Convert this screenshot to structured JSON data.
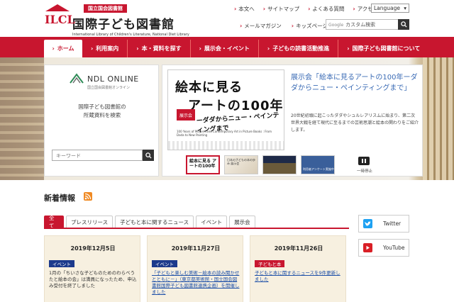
{
  "header": {
    "logo_mark": "ILCL",
    "logo_top": "国立国会図書館",
    "logo_main": "国際子ども図書館",
    "logo_sub": "International Library of Children's Literature, National Diet Library",
    "util_links": [
      "本文へ",
      "サイトマップ",
      "よくある質問",
      "アクセス"
    ],
    "language": "Language",
    "util_links2": [
      "メールマガジン",
      "キッズページ"
    ],
    "search_brand": "Google",
    "search_placeholder": "カスタム検索"
  },
  "nav": {
    "items": [
      "ホーム",
      "利用案内",
      "本・資料を探す",
      "展示会・イベント",
      "子どもの読書活動推進",
      "国際子ども図書館について"
    ]
  },
  "ndl": {
    "title": "NDL ONLINE",
    "sub": "国立国会図書館オンライン",
    "desc_line1": "国際子ども図書館の",
    "desc_line2": "所蔵資料を検索",
    "keyword_placeholder": "キーワード"
  },
  "exhibit": {
    "poster_line1": "絵本に見る",
    "poster_line2": "アートの100年",
    "poster_badge": "展示会",
    "poster_line3": "ーダダからニュー・ペインティングまで",
    "poster_small": "100 Years of Modern and Contemporary Art in Picture Books : From Dada to New Painting",
    "title": "展示会「絵本に見るアートの100年ーダダからニュー・ペインティングまで」",
    "desc": "20世紀初頭に起こったダダやシュルレアリスムに始まり、第二次世界大戦を経て現代に至るまでの芸術思潮と絵本の関わりをご紹介します。",
    "thumb1": "絵本に見る アートの100年",
    "thumb2": "日本の子どもの本の歩み 展示会",
    "thumb4": "利用者アンケート実施中",
    "pause_label": "一時停止"
  },
  "news": {
    "title": "新着情報",
    "tabs": [
      "全て",
      "プレスリリース",
      "子どもと本に関するニュース",
      "イベント",
      "展示会"
    ],
    "cards": [
      {
        "date": "2019年12月5日",
        "category": "イベント",
        "body": "1月の「ちいさな子どものためのわらべうたと絵本の会」は満員になったため、申込み受付を終了しました"
      },
      {
        "date": "2019年11月27日",
        "category": "イベント",
        "body": "「子どもと楽しむ美術－絵本の読み聞かせとともに－」（東京都美術館・国立国会図書館国際子ども図書館連携企画）を開催しました"
      },
      {
        "date": "2019年11月26日",
        "category": "子どもと本",
        "body": "子どもと本に関するニュースを9件更新しました"
      }
    ]
  },
  "social": {
    "twitter": "Twitter",
    "youtube": "YouTube"
  }
}
